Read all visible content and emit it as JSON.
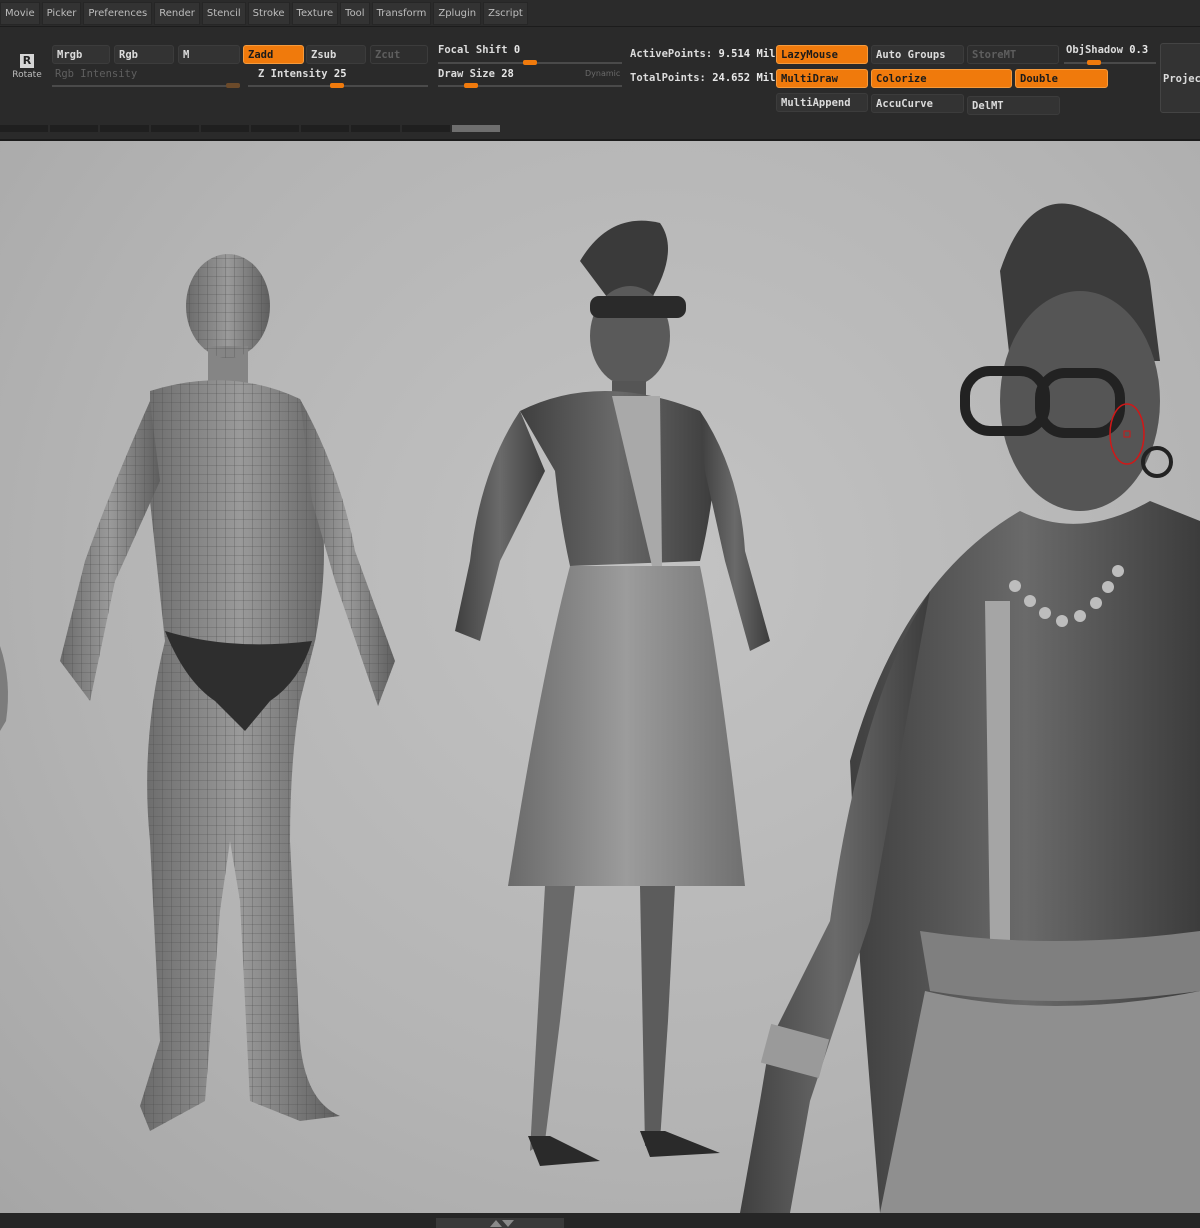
{
  "menu": [
    "Movie",
    "Picker",
    "Preferences",
    "Render",
    "Stencil",
    "Stroke",
    "Texture",
    "Tool",
    "Transform",
    "Zplugin",
    "Zscript"
  ],
  "shelf": {
    "rotate_label": "Rotate",
    "rotate_glyph": "R",
    "mrgb": "Mrgb",
    "rgb": "Rgb",
    "m": "M",
    "zadd": "Zadd",
    "zsub": "Zsub",
    "zcut": "Zcut",
    "rgb_intensity": "Rgb Intensity",
    "z_intensity_label": "Z Intensity",
    "z_intensity_value": "25",
    "focal_shift_label": "Focal Shift",
    "focal_shift_value": "0",
    "draw_size_label": "Draw Size",
    "draw_size_value": "28",
    "dynamic": "Dynamic",
    "active_points_label": "ActivePoints:",
    "active_points_value": "9.514 Mil",
    "total_points_label": "TotalPoints:",
    "total_points_value": "24.652 Mil",
    "lazymouse": "LazyMouse",
    "auto_groups": "Auto Groups",
    "storemt": "StoreMT",
    "objshadow_label": "ObjShadow",
    "objshadow_value": "0.3",
    "multidraw": "MultiDraw",
    "colorize": "Colorize",
    "double": "Double",
    "multiappend": "MultiAppend",
    "accucurve": "AccuCurve",
    "delmt": "DelMT",
    "project": "Projec"
  },
  "colors": {
    "accent": "#f07a0c",
    "panel": "#2a2a2a",
    "viewport": "#b8b8b8",
    "brush_ring": "#d01818"
  },
  "icons": {
    "rotate": "rotate-icon",
    "brush": "brush-cursor-icon"
  }
}
